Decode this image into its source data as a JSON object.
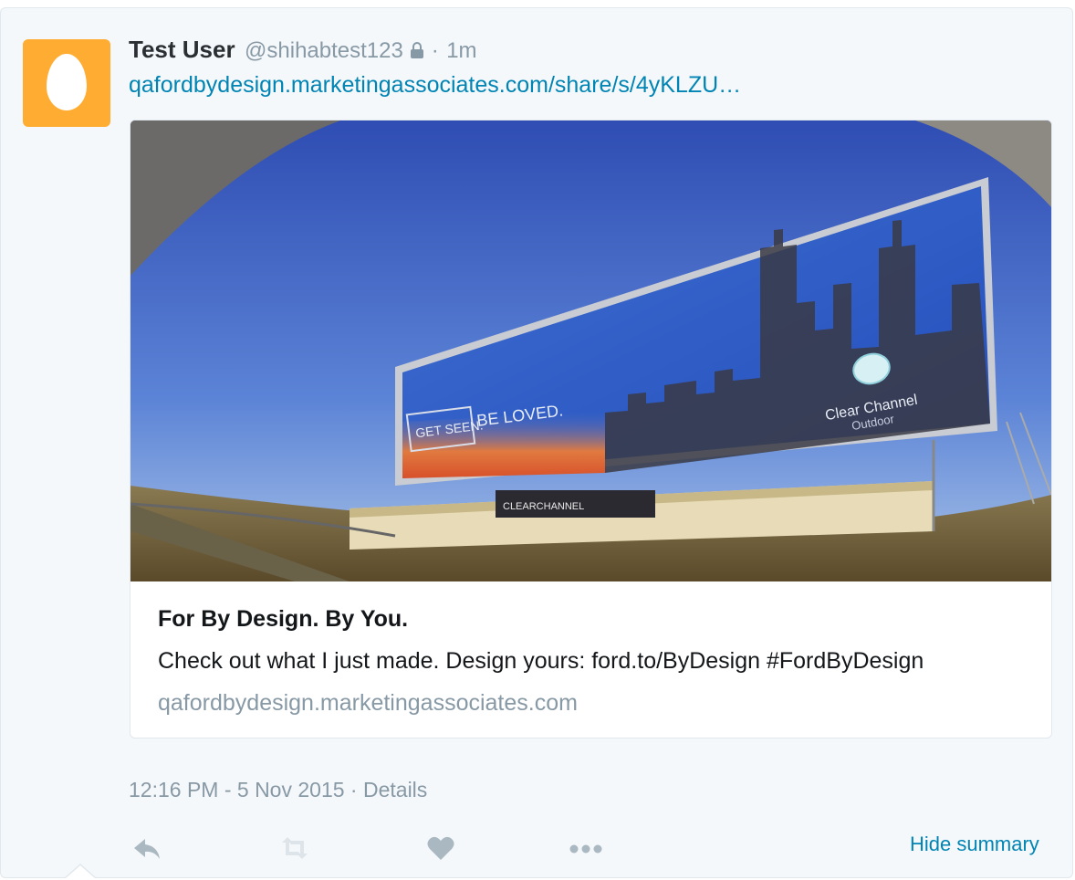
{
  "tweet": {
    "fullname": "Test User",
    "username": "@shihabtest123",
    "separator": "·",
    "time": "1m",
    "link": "qafordbydesign.marketingassociates.com/share/s/4yKLZU…"
  },
  "card": {
    "image_label": "Clear Channel billboard photo",
    "billboard_text_left": "GET SEEN.",
    "billboard_text_right": "BE LOVED.",
    "billboard_brand": "Clear Channel",
    "billboard_brand_sub": "Outdoor",
    "title": "For By Design. By You.",
    "description": "Check out what I just made. Design yours: ford.to/ByDesign #FordByDesign",
    "domain": "qafordbydesign.marketingassociates.com"
  },
  "footer": {
    "timestamp": "12:16 PM - 5 Nov 2015",
    "separator": " · ",
    "details": "Details",
    "hide_summary": "Hide summary"
  },
  "icons": {
    "reply": "reply-icon",
    "retweet": "retweet-icon",
    "like": "heart-icon",
    "more": "more-icon",
    "lock": "lock-icon"
  },
  "colors": {
    "link": "#0084b4",
    "meta": "#8899a6",
    "avatar": "#ffac33",
    "action": "#aab8c2"
  }
}
